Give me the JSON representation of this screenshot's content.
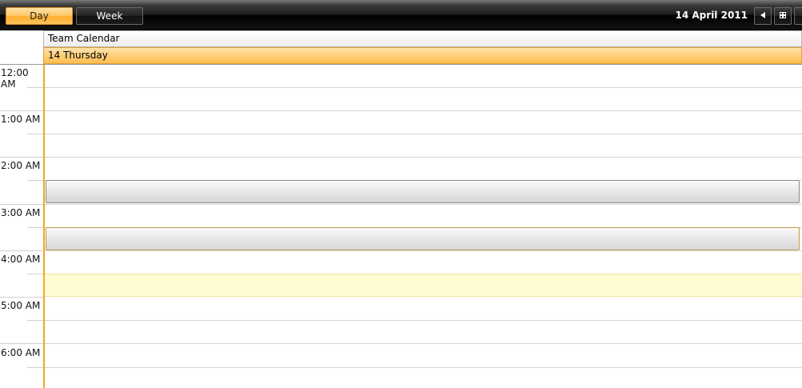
{
  "toolbar": {
    "day_label": "Day",
    "week_label": "Week",
    "current_date": "14 April 2011",
    "prev_icon": "triangle-left-icon",
    "calendar_icon": "calendar-grid-icon"
  },
  "header": {
    "resource_name": "Team Calendar",
    "day_label": "14 Thursday"
  },
  "timeline": {
    "hours": [
      "12:00 AM",
      "1:00 AM",
      "2:00 AM",
      "3:00 AM",
      "4:00 AM",
      "5:00 AM",
      "6:00 AM"
    ]
  },
  "colors": {
    "accent": "#ffb84a",
    "current_time": "#f5a623",
    "highlight_slot": "#fffbd2",
    "toolbar_bg": "#1c1c1c"
  }
}
